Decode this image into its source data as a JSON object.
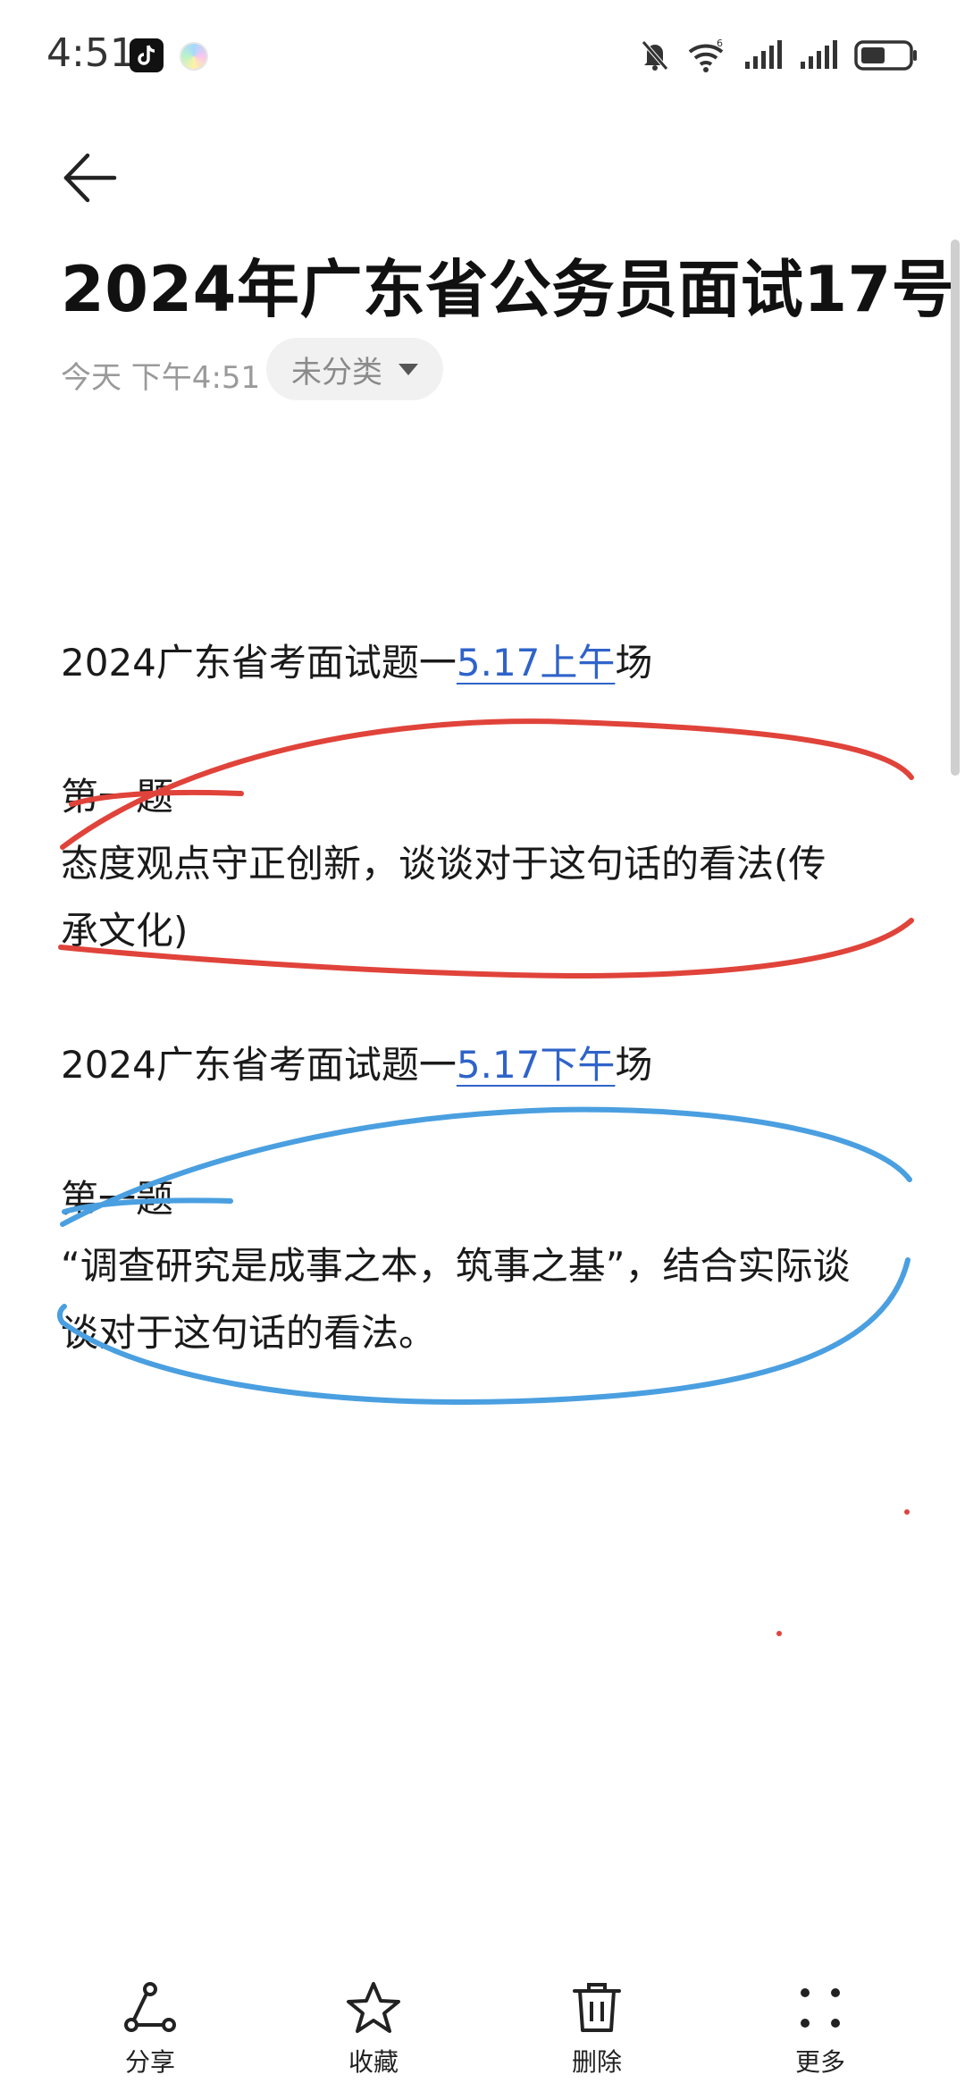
{
  "status_bar": {
    "time": "4:51",
    "icons": [
      "tiktok-icon",
      "app-icon",
      "mute-bell-icon",
      "wifi-icon",
      "signal-icon",
      "signal-icon",
      "battery-icon"
    ]
  },
  "note": {
    "title": "2024年广东省公务员面试17号",
    "date": "今天 下午4:51",
    "category": "未分类",
    "sections": [
      {
        "heading_prefix": "2024广东省考面试题一",
        "heading_link": "5.17上午",
        "heading_suffix": "场",
        "question_label": "第一题",
        "question_line1": "态度观点守正创新，谈谈对于这句话的看法(传",
        "question_line2": "承文化)"
      },
      {
        "heading_prefix": "2024广东省考面试题一",
        "heading_link": "5.17下午",
        "heading_suffix": "场",
        "question_label": "第一题",
        "question_line1": "“调查研究是成事之本，筑事之基”，结合实际谈",
        "question_line2": "谈对于这句话的看法。"
      }
    ],
    "ink_colors": {
      "red": "#e0433a",
      "blue": "#4a9fe0"
    }
  },
  "bottom_bar": {
    "share_label": "分享",
    "favorite_label": "收藏",
    "delete_label": "删除",
    "more_label": "更多"
  }
}
